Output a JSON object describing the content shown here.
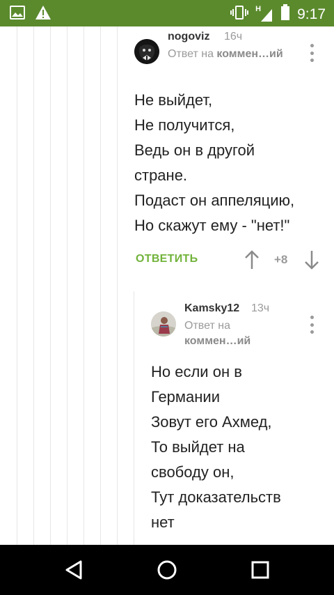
{
  "status_bar": {
    "time": "9:17",
    "network_label": "H",
    "icons": [
      "image-icon",
      "warning-icon",
      "vibrate-icon",
      "signal-icon",
      "battery-icon"
    ]
  },
  "comments": [
    {
      "username": "nogoviz",
      "age": "16ч",
      "reply_prefix": "Ответ на",
      "reply_target": "коммен…ий",
      "reply_target_tail": "ий",
      "text": "Не выйдет,\nНе получится,\nВедь он в другой\nстране.\nПодаст он аппеляцию,\nНо скажут ему - \"нет!\"",
      "reply_label": "ОТВЕТИТЬ",
      "score": "+8"
    },
    {
      "username": "Kamsky12",
      "age": "13ч",
      "reply_prefix": "Ответ на",
      "reply_target": "коммен…ий",
      "text": "Но если он в\nГермании\nЗовут его Ахмед,\nТо выйдет на\nсвободу он,\nТут доказательств\nнет"
    }
  ],
  "colors": {
    "status_bar": "#5b8a2d",
    "accent_green": "#71b33a",
    "muted_gray": "#9a9a9a"
  },
  "nav_bar": {
    "icons": [
      "back-icon",
      "home-icon",
      "recents-icon"
    ]
  }
}
